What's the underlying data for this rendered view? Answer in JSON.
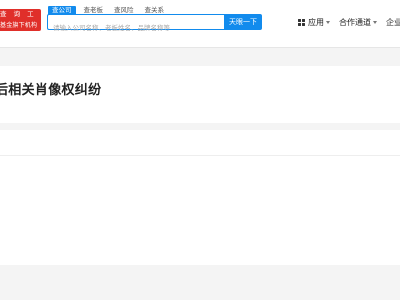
{
  "header": {
    "logo": {
      "top_text": "查 询 工 具",
      "sub_text": "基金旗下机构"
    },
    "search": {
      "tabs": [
        {
          "label": "查公司",
          "active": true
        },
        {
          "label": "查老板",
          "active": false
        },
        {
          "label": "查风险",
          "active": false
        },
        {
          "label": "查关系",
          "active": false
        }
      ],
      "placeholder": "请输入公司名称、老板姓名、品牌名称等",
      "value": "",
      "button_label": "天眼一下"
    },
    "nav": {
      "apps_label": "应用",
      "partner_label": "合作通道",
      "enterprise_label": "企业"
    }
  },
  "main": {
    "title": "后相关肖像权纠纷"
  },
  "colors": {
    "brand_red": "#e02f2a",
    "accent_blue": "#128bed",
    "page_background": "#f4f4f4"
  }
}
